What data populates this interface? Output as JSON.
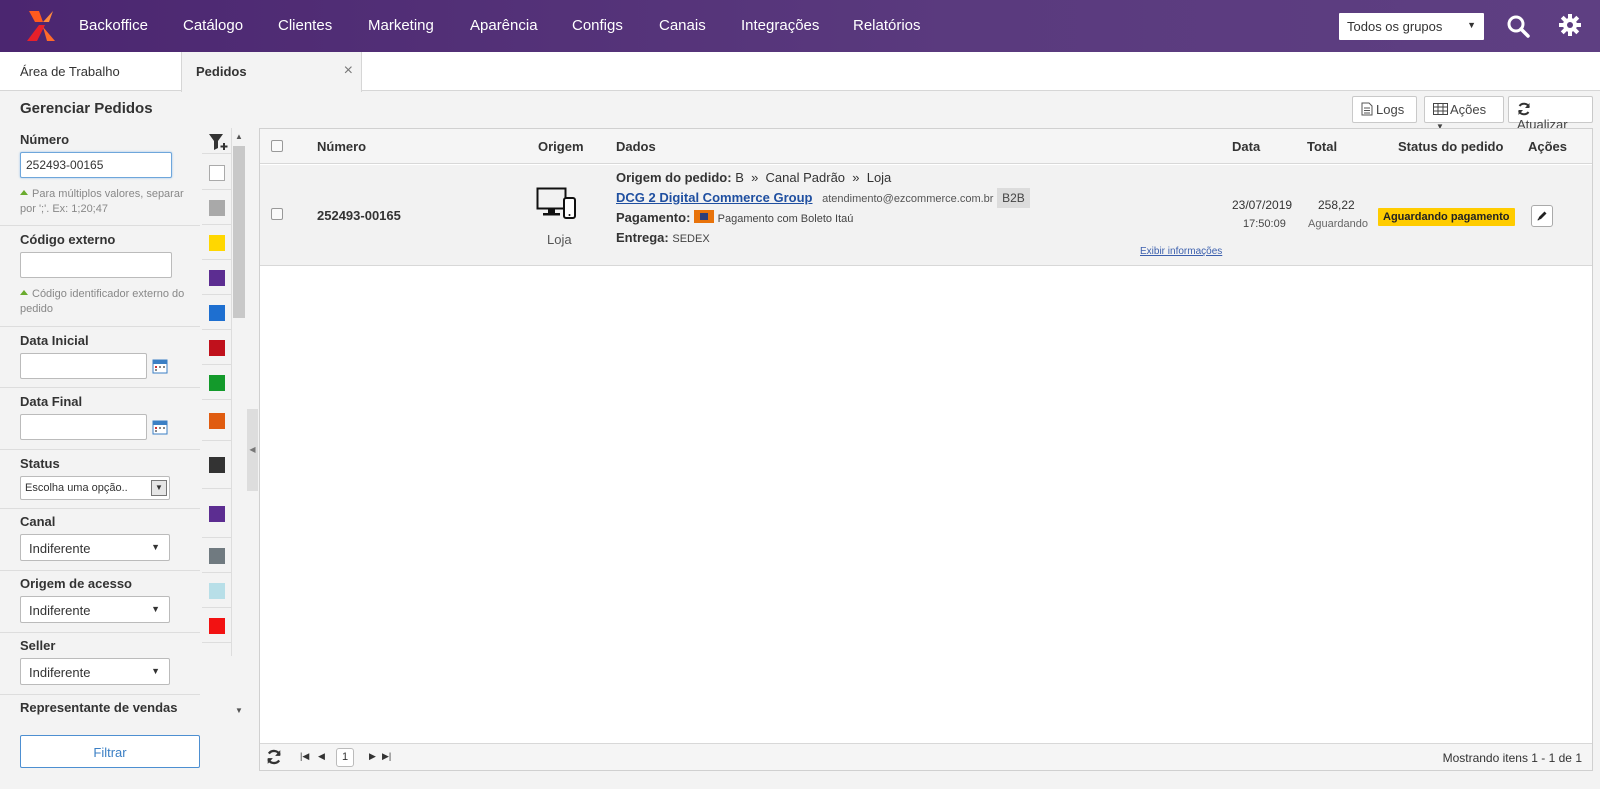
{
  "nav": {
    "items": [
      "Backoffice",
      "Catálogo",
      "Clientes",
      "Marketing",
      "Aparência",
      "Configs",
      "Canais",
      "Integrações",
      "Relatórios"
    ],
    "group_select": "Todos os grupos"
  },
  "tabs": {
    "work": "Área de Trabalho",
    "orders": "Pedidos",
    "close": "×"
  },
  "page": {
    "title": "Gerenciar Pedidos",
    "logs": "Logs",
    "acoes": "Ações",
    "atualizar": "Atualizar"
  },
  "filters": {
    "numero_label": "Número",
    "numero_value": "252493-00165",
    "numero_hint": "Para múltiplos valores, separar por ';'. Ex: 1;20;47",
    "codigo_label": "Código externo",
    "codigo_hint": "Código identificador externo do pedido",
    "data_inicial_label": "Data Inicial",
    "data_final_label": "Data Final",
    "status_label": "Status",
    "status_value": "Escolha uma opção..",
    "canal_label": "Canal",
    "canal_value": "Indiferente",
    "origem_label": "Origem de acesso",
    "origem_value": "Indiferente",
    "seller_label": "Seller",
    "seller_value": "Indiferente",
    "next_label": "Representante de vendas",
    "filter_button": "Filtrar"
  },
  "colors": [
    "#ffffff",
    "#a9a9a9",
    "#ffd700",
    "#5c2d91",
    "#1e6fd0",
    "#c0111c",
    "#139a2b",
    "#e05c10",
    "#333333",
    "#5c2d91",
    "#707a80",
    "#b8dfe8",
    "#f21212"
  ],
  "grid": {
    "headers": {
      "numero": "Número",
      "origem": "Origem",
      "dados": "Dados",
      "data": "Data",
      "total": "Total",
      "status": "Status do pedido",
      "acoes": "Ações"
    },
    "row": {
      "numero": "252493-00165",
      "origem": "Loja",
      "origem_pedido_label": "Origem do pedido:",
      "origem_pedido_value": "B  »  Canal Padrão  »  Loja",
      "customer": "DCG 2 Digital Commerce Group",
      "email": "atendimento@ezcommerce.com.br",
      "segment": "B2B",
      "pagamento_label": "Pagamento:",
      "pagamento_value": "Pagamento com Boleto Itaú",
      "entrega_label": "Entrega:",
      "entrega_value": "SEDEX",
      "exibir": "Exibir informações",
      "date": "23/07/2019",
      "time": "17:50:09",
      "total": "258,22",
      "total_status": "Aguardando",
      "status": "Aguardando pagamento"
    },
    "footer": {
      "page": "1",
      "info": "Mostrando itens 1 - 1 de 1"
    }
  }
}
